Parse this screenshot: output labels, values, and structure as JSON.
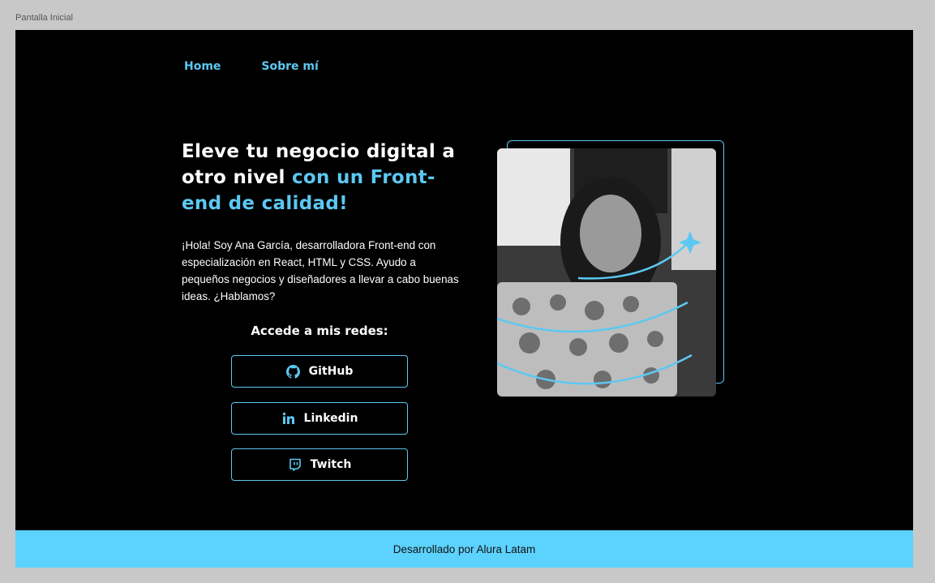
{
  "canvas": {
    "frame_label": "Pantalla Inicial"
  },
  "nav": {
    "home": "Home",
    "about": "Sobre mí"
  },
  "hero": {
    "title_part1": "Eleve tu negocio digital a otro nivel ",
    "title_accent": "con un Front-end de calidad!",
    "bio": "¡Hola! Soy Ana García, desarrolladora Front-end con especialización en React, HTML y CSS. Ayudo a pequeños negocios y diseñadores a llevar a cabo buenas ideas. ¿Hablamos?"
  },
  "social": {
    "heading": "Accede a mis redes:",
    "buttons": [
      {
        "label": "GitHub",
        "icon": "github-icon"
      },
      {
        "label": "Linkedin",
        "icon": "linkedin-icon"
      },
      {
        "label": "Twitch",
        "icon": "twitch-icon"
      }
    ]
  },
  "photo": {
    "alt": "profile-photo"
  },
  "footer": {
    "text": "Desarrollado por Alura Latam"
  },
  "colors": {
    "accent": "#5cc8f2",
    "footer_bg": "#5cd3ff",
    "background": "#000000"
  }
}
